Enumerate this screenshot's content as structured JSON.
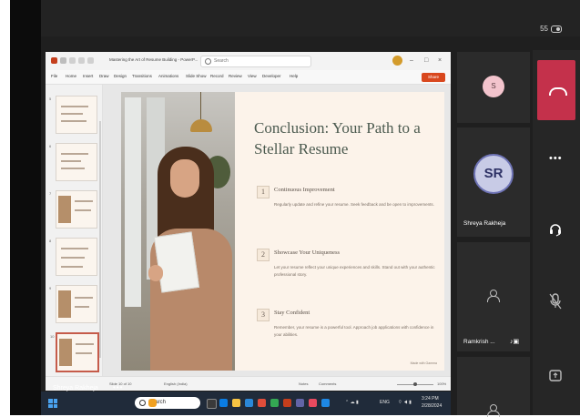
{
  "meeting": {
    "participant_count": "55"
  },
  "shared_window": {
    "doc_title": "Mastering the Art of Resume Building - PowerP...",
    "search_placeholder": "Search",
    "ribbon_tabs": [
      "File",
      "Home",
      "Insert",
      "Draw",
      "Design",
      "Transitions",
      "Animations",
      "Slide Show",
      "Record",
      "Review",
      "View",
      "Developer",
      "Help"
    ],
    "share_button": "Share",
    "thumbnail_numbers": [
      "5",
      "6",
      "7",
      "8",
      "9",
      "10"
    ],
    "slide": {
      "title": "Conclusion: Your Path to a Stellar Resume",
      "items": [
        {
          "num": "1",
          "heading": "Continuous Improvement",
          "body": "Regularly update and refine your resume. Seek feedback and be open to improvements."
        },
        {
          "num": "2",
          "heading": "Showcase Your Uniqueness",
          "body": "Let your resume reflect your unique experiences and skills. Stand out with your authentic professional story."
        },
        {
          "num": "3",
          "heading": "Stay Confident",
          "body": "Remember, your resume is a powerful tool. Approach job applications with confidence in your abilities."
        }
      ],
      "credit": "Made with Gamma"
    },
    "status": {
      "left": "Slide 10 of 10",
      "language": "English (India)",
      "notes": "Notes",
      "comments": "Comments",
      "zoom": "100%"
    }
  },
  "presenter": {
    "name": "Shreya Rakheja",
    "more": "•••"
  },
  "taskbar": {
    "search_label": "Search",
    "tray_text": "ENG",
    "time": "3:24 PM",
    "date": "2/28/2024"
  },
  "participants": [
    {
      "initials": "S",
      "name": ""
    },
    {
      "initials": "SR",
      "name": "Shreya Rakheja"
    },
    {
      "initials": "",
      "name": "Ramkrish ..."
    }
  ],
  "controls": {
    "more_label": "•••"
  },
  "colors": {
    "hangup": "#c4314b",
    "presenter_avatar_ring": "#6e73b5",
    "share_button": "#d9481e"
  }
}
